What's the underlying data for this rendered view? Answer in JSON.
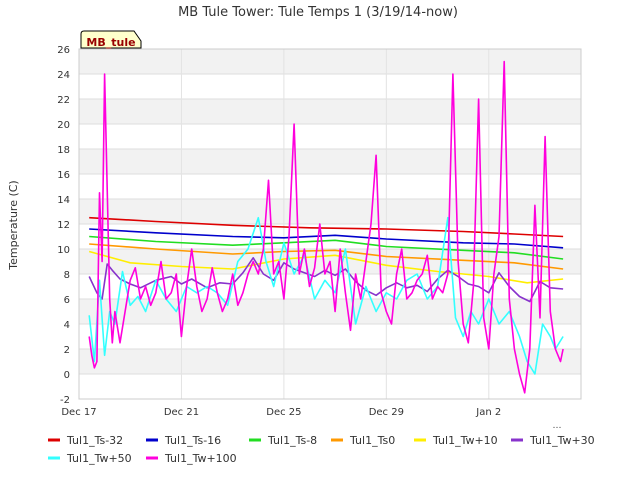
{
  "chart_data": {
    "type": "line",
    "title": "MB Tule Tower: Tule Temps 1 (3/19/14-now)",
    "ylabel": "Temperature (C)",
    "xlabel": "",
    "station_badge": "MB_tule",
    "axis_corner_mark": "…",
    "ylim": [
      -2,
      26
    ],
    "yticks": [
      -2,
      0,
      2,
      4,
      6,
      8,
      10,
      12,
      14,
      16,
      18,
      20,
      22,
      24,
      26
    ],
    "xlim": [
      0,
      19.6
    ],
    "xticks": [
      {
        "value": 0,
        "label": "Dec 17"
      },
      {
        "value": 4,
        "label": "Dec 21"
      },
      {
        "value": 8,
        "label": "Dec 25"
      },
      {
        "value": 12,
        "label": "Dec 29"
      },
      {
        "value": 16,
        "label": "Jan 2"
      }
    ],
    "grid": true,
    "legend_position": "bottom",
    "series": [
      {
        "name": "Tul1_Ts-32",
        "color": "#dd0000",
        "x": [
          0.4,
          3,
          6,
          9,
          12,
          15,
          17,
          18.9
        ],
        "y": [
          12.5,
          12.2,
          11.9,
          11.7,
          11.6,
          11.4,
          11.2,
          11.0
        ]
      },
      {
        "name": "Tul1_Ts-16",
        "color": "#0000cc",
        "x": [
          0.4,
          3,
          6,
          8,
          10,
          12,
          15,
          17,
          18.9
        ],
        "y": [
          11.6,
          11.3,
          11.0,
          10.9,
          11.1,
          10.8,
          10.5,
          10.4,
          10.1
        ]
      },
      {
        "name": "Tul1_Ts-8",
        "color": "#22dd22",
        "x": [
          0.4,
          3,
          6,
          8,
          10,
          12,
          15,
          17,
          18.9
        ],
        "y": [
          11.0,
          10.6,
          10.3,
          10.5,
          10.7,
          10.2,
          9.9,
          9.7,
          9.2
        ]
      },
      {
        "name": "Tul1_Ts0",
        "color": "#ff9900",
        "x": [
          0.4,
          3,
          6,
          8,
          10,
          12,
          15,
          17,
          18.9
        ],
        "y": [
          10.4,
          10.0,
          9.6,
          9.8,
          9.9,
          9.4,
          9.1,
          8.9,
          8.4
        ]
      },
      {
        "name": "Tul1_Tw+10",
        "color": "#ffee00",
        "x": [
          0.4,
          2,
          4,
          6,
          8,
          10,
          12,
          14,
          16,
          17.5,
          18.9
        ],
        "y": [
          9.8,
          8.9,
          8.6,
          8.4,
          9.2,
          9.5,
          8.7,
          8.2,
          7.8,
          7.3,
          7.6
        ]
      },
      {
        "name": "Tul1_Tw+30",
        "color": "#8833cc",
        "x": [
          0.4,
          0.7,
          0.9,
          1.1,
          1.3,
          1.6,
          2,
          2.4,
          3,
          3.6,
          4,
          4.4,
          5,
          5.5,
          6,
          6.4,
          6.8,
          7.2,
          7.6,
          8,
          8.4,
          8.8,
          9.2,
          9.6,
          10,
          10.4,
          10.8,
          11.2,
          11.6,
          12,
          12.4,
          12.8,
          13.2,
          13.6,
          14,
          14.4,
          14.8,
          15.2,
          15.6,
          16,
          16.4,
          16.8,
          17.2,
          17.6,
          18,
          18.4,
          18.9
        ],
        "y": [
          7.8,
          6.5,
          6.0,
          8.8,
          8.3,
          7.6,
          7.2,
          6.9,
          7.5,
          7.8,
          7.2,
          7.6,
          6.9,
          7.3,
          7.2,
          8.1,
          9.3,
          8.0,
          7.5,
          8.9,
          8.4,
          8.1,
          7.8,
          8.3,
          7.9,
          8.4,
          7.4,
          6.7,
          6.3,
          6.9,
          7.3,
          6.9,
          7.1,
          6.6,
          7.6,
          8.3,
          7.8,
          7.2,
          7.0,
          6.5,
          8.1,
          7.0,
          6.2,
          5.8,
          7.4,
          6.9,
          6.8
        ]
      },
      {
        "name": "Tul1_Tw+50",
        "color": "#33ffff",
        "x": [
          0.4,
          0.6,
          0.8,
          1.0,
          1.2,
          1.4,
          1.7,
          2.0,
          2.3,
          2.6,
          3.0,
          3.4,
          3.8,
          4.2,
          4.6,
          5.0,
          5.4,
          5.8,
          6.2,
          6.6,
          7.0,
          7.3,
          7.6,
          8.0,
          8.4,
          8.8,
          9.2,
          9.6,
          10.0,
          10.4,
          10.8,
          11.2,
          11.6,
          12.0,
          12.4,
          12.8,
          13.2,
          13.6,
          14.0,
          14.4,
          14.7,
          15.0,
          15.3,
          15.6,
          16.0,
          16.4,
          16.8,
          17.2,
          17.5,
          17.8,
          18.1,
          18.4,
          18.6,
          18.9
        ],
        "y": [
          4.7,
          1.0,
          7.5,
          1.5,
          5.0,
          4.0,
          8.2,
          5.5,
          6.2,
          5.0,
          7.5,
          6.0,
          5.0,
          7.0,
          6.5,
          7.0,
          6.5,
          5.5,
          9.0,
          10.0,
          12.5,
          9.0,
          7.0,
          10.5,
          8.0,
          9.5,
          6.0,
          7.5,
          6.5,
          10.0,
          4.0,
          7.0,
          5.0,
          6.5,
          6.0,
          7.5,
          8.0,
          6.0,
          7.0,
          12.5,
          4.5,
          3.0,
          5.0,
          4.0,
          6.0,
          4.0,
          5.0,
          3.0,
          1.0,
          0.0,
          4.0,
          3.0,
          2.0,
          3.0
        ]
      },
      {
        "name": "Tul1_Tw+100",
        "color": "#ff00dd",
        "x": [
          0.4,
          0.5,
          0.6,
          0.7,
          0.8,
          0.9,
          1.0,
          1.2,
          1.3,
          1.4,
          1.6,
          1.8,
          2.0,
          2.2,
          2.4,
          2.6,
          2.8,
          3.0,
          3.2,
          3.4,
          3.6,
          3.8,
          4.0,
          4.2,
          4.4,
          4.6,
          4.8,
          5.0,
          5.2,
          5.4,
          5.6,
          5.8,
          6.0,
          6.2,
          6.4,
          6.6,
          6.8,
          7.0,
          7.2,
          7.4,
          7.6,
          7.8,
          8.0,
          8.2,
          8.4,
          8.6,
          8.8,
          9.0,
          9.2,
          9.4,
          9.6,
          9.8,
          10.0,
          10.2,
          10.4,
          10.6,
          10.8,
          11.0,
          11.2,
          11.4,
          11.6,
          11.8,
          12.0,
          12.2,
          12.4,
          12.6,
          12.8,
          13.0,
          13.2,
          13.4,
          13.6,
          13.8,
          14.0,
          14.2,
          14.4,
          14.6,
          14.8,
          15.0,
          15.2,
          15.4,
          15.6,
          15.8,
          16.0,
          16.2,
          16.4,
          16.6,
          16.8,
          17.0,
          17.2,
          17.4,
          17.6,
          17.8,
          18.0,
          18.2,
          18.4,
          18.6,
          18.8,
          18.9
        ],
        "y": [
          3.0,
          1.5,
          0.5,
          1.0,
          14.5,
          9.0,
          24.0,
          6.0,
          2.5,
          5.0,
          2.5,
          5.0,
          7.5,
          8.5,
          6.0,
          7.0,
          5.5,
          6.5,
          9.0,
          6.0,
          6.5,
          8.0,
          3.0,
          7.0,
          10.0,
          7.0,
          5.0,
          6.0,
          8.5,
          6.5,
          5.0,
          6.0,
          8.0,
          5.5,
          6.5,
          8.0,
          9.0,
          8.0,
          10.0,
          15.5,
          8.0,
          9.0,
          6.0,
          11.0,
          20.0,
          8.0,
          10.0,
          7.0,
          8.5,
          12.0,
          8.0,
          9.0,
          5.0,
          10.0,
          6.5,
          3.5,
          8.0,
          6.0,
          9.0,
          12.0,
          17.5,
          6.5,
          5.0,
          4.0,
          8.0,
          10.0,
          6.0,
          6.5,
          7.5,
          8.0,
          9.5,
          6.0,
          7.0,
          6.5,
          8.0,
          24.0,
          9.0,
          4.0,
          2.5,
          7.0,
          22.0,
          4.5,
          2.0,
          8.0,
          11.0,
          25.0,
          6.0,
          2.0,
          0.0,
          -1.5,
          2.0,
          13.5,
          4.5,
          19.0,
          5.0,
          2.0,
          1.0,
          2.0
        ]
      }
    ]
  }
}
